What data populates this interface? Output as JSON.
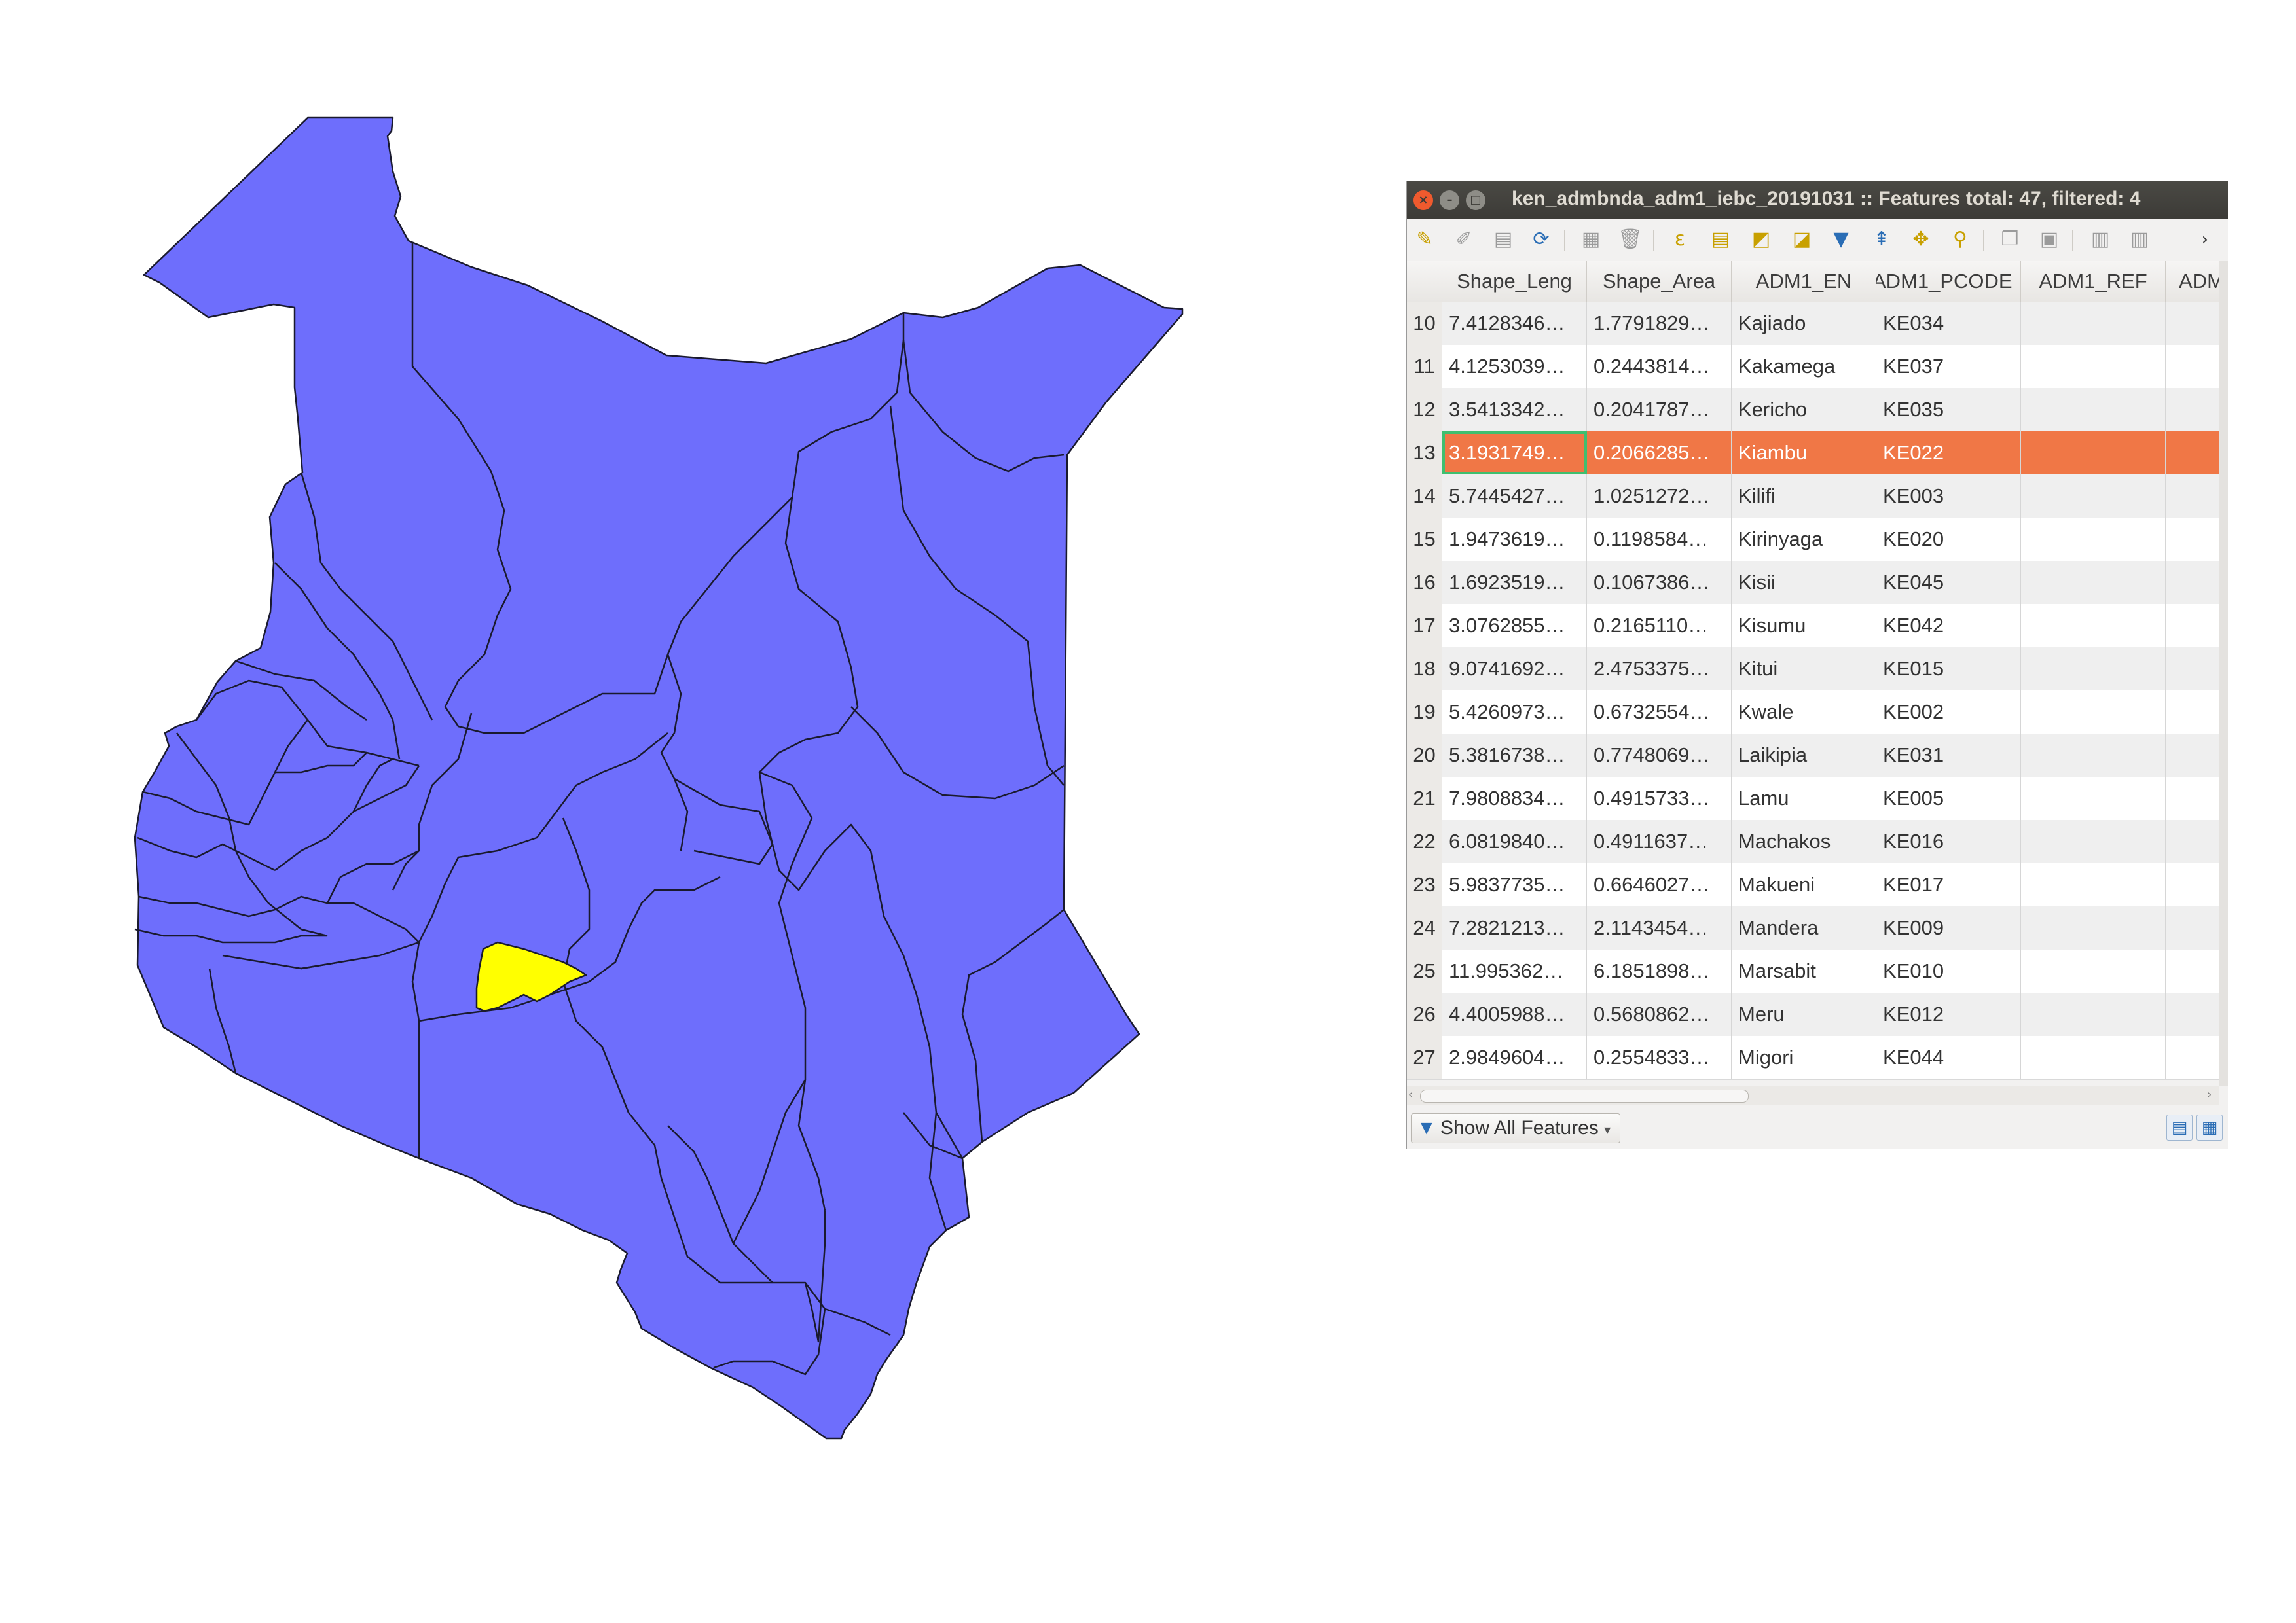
{
  "map": {
    "fill_color": "#6e6efc",
    "border_color": "#1a1a2e",
    "highlight_color": "#ffff00",
    "highlighted_feature": "Kiambu"
  },
  "window": {
    "title": "ken_admbnda_adm1_iebc_20191031 :: Features total: 47, filtered: 4",
    "buttons": [
      "close-icon",
      "minimize-icon",
      "maximize-icon"
    ]
  },
  "toolbar": {
    "icons": [
      "pencil-icon",
      "save-edits-icon",
      "save-icon",
      "reload-icon",
      "add-feature-icon",
      "delete-icon",
      "select-expression-icon",
      "select-all-icon",
      "invert-selection-icon",
      "deselect-icon",
      "filter-icon",
      "move-selection-top-icon",
      "pan-to-selection-icon",
      "zoom-to-selection-icon",
      "copy-icon",
      "paste-icon",
      "new-field-icon",
      "delete-field-icon",
      "more-icon"
    ]
  },
  "table": {
    "columns": [
      "Shape_Leng",
      "Shape_Area",
      "ADM1_EN",
      "ADM1_PCODE",
      "ADM1_REF",
      "ADM"
    ],
    "rows": [
      {
        "n": "10",
        "leng": "7.4128346…",
        "area": "1.7791829…",
        "name": "Kajiado",
        "pcode": "KE034",
        "ref": "",
        "adm": ""
      },
      {
        "n": "11",
        "leng": "4.1253039…",
        "area": "0.2443814…",
        "name": "Kakamega",
        "pcode": "KE037",
        "ref": "",
        "adm": ""
      },
      {
        "n": "12",
        "leng": "3.5413342…",
        "area": "0.2041787…",
        "name": "Kericho",
        "pcode": "KE035",
        "ref": "",
        "adm": ""
      },
      {
        "n": "13",
        "leng": "3.1931749…",
        "area": "0.2066285…",
        "name": "Kiambu",
        "pcode": "KE022",
        "ref": "",
        "adm": "",
        "selected": true
      },
      {
        "n": "14",
        "leng": "5.7445427…",
        "area": "1.0251272…",
        "name": "Kilifi",
        "pcode": "KE003",
        "ref": "",
        "adm": ""
      },
      {
        "n": "15",
        "leng": "1.9473619…",
        "area": "0.1198584…",
        "name": "Kirinyaga",
        "pcode": "KE020",
        "ref": "",
        "adm": ""
      },
      {
        "n": "16",
        "leng": "1.6923519…",
        "area": "0.1067386…",
        "name": "Kisii",
        "pcode": "KE045",
        "ref": "",
        "adm": ""
      },
      {
        "n": "17",
        "leng": "3.0762855…",
        "area": "0.2165110…",
        "name": "Kisumu",
        "pcode": "KE042",
        "ref": "",
        "adm": ""
      },
      {
        "n": "18",
        "leng": "9.0741692…",
        "area": "2.4753375…",
        "name": "Kitui",
        "pcode": "KE015",
        "ref": "",
        "adm": ""
      },
      {
        "n": "19",
        "leng": "5.4260973…",
        "area": "0.6732554…",
        "name": "Kwale",
        "pcode": "KE002",
        "ref": "",
        "adm": ""
      },
      {
        "n": "20",
        "leng": "5.3816738…",
        "area": "0.7748069…",
        "name": "Laikipia",
        "pcode": "KE031",
        "ref": "",
        "adm": ""
      },
      {
        "n": "21",
        "leng": "7.9808834…",
        "area": "0.4915733…",
        "name": "Lamu",
        "pcode": "KE005",
        "ref": "",
        "adm": ""
      },
      {
        "n": "22",
        "leng": "6.0819840…",
        "area": "0.4911637…",
        "name": "Machakos",
        "pcode": "KE016",
        "ref": "",
        "adm": ""
      },
      {
        "n": "23",
        "leng": "5.9837735…",
        "area": "0.6646027…",
        "name": "Makueni",
        "pcode": "KE017",
        "ref": "",
        "adm": ""
      },
      {
        "n": "24",
        "leng": "7.2821213…",
        "area": "2.1143454…",
        "name": "Mandera",
        "pcode": "KE009",
        "ref": "",
        "adm": ""
      },
      {
        "n": "25",
        "leng": "11.995362…",
        "area": "6.1851898…",
        "name": "Marsabit",
        "pcode": "KE010",
        "ref": "",
        "adm": ""
      },
      {
        "n": "26",
        "leng": "4.4005988…",
        "area": "0.5680862…",
        "name": "Meru",
        "pcode": "KE012",
        "ref": "",
        "adm": ""
      },
      {
        "n": "27",
        "leng": "2.9849604…",
        "area": "0.2554833…",
        "name": "Migori",
        "pcode": "KE044",
        "ref": "",
        "adm": ""
      }
    ]
  },
  "bottom": {
    "show_all_label": "Show All Features",
    "view_icons": [
      "form-view-icon",
      "table-view-icon"
    ]
  }
}
